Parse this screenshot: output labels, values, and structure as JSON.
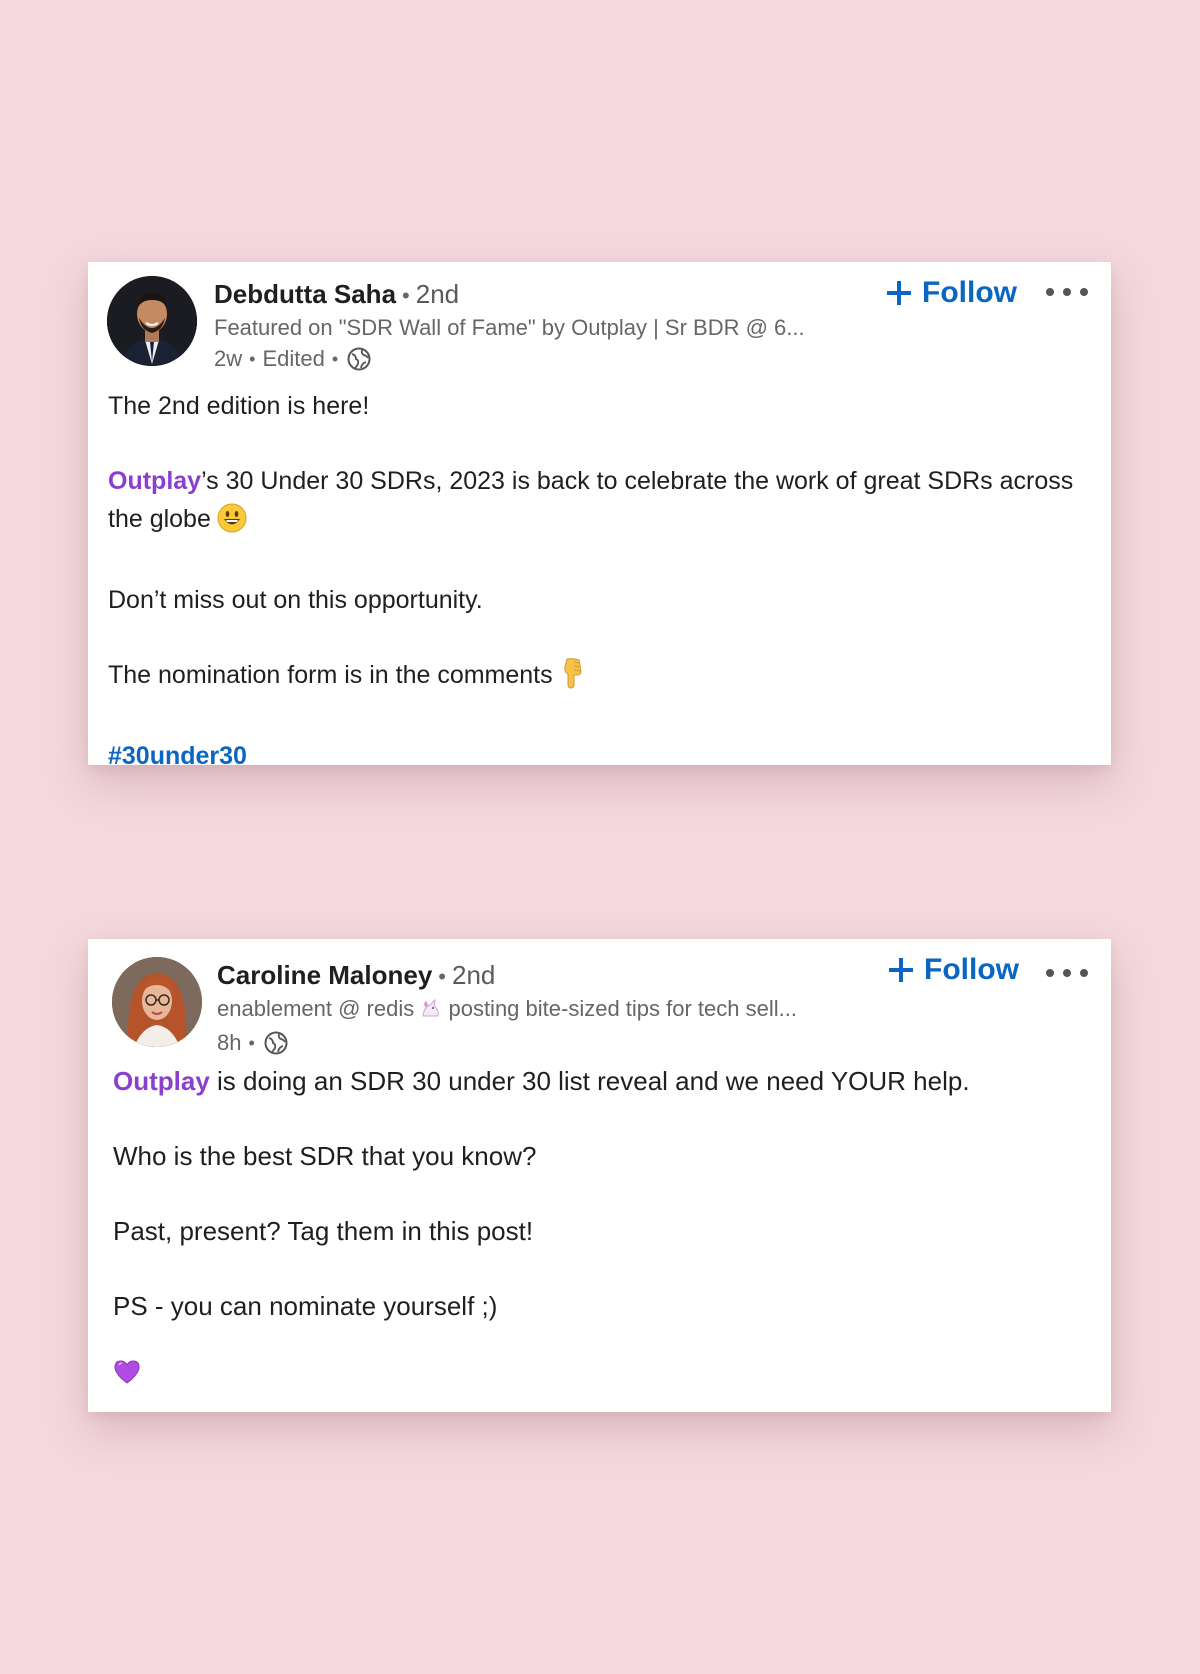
{
  "posts": [
    {
      "author": "Debdutta Saha",
      "degree": "2nd",
      "headline": "Featured on \"SDR Wall of Fame\" by Outplay | Sr BDR @ 6...",
      "time": "2w",
      "edited": "Edited",
      "follow_label": "Follow",
      "line1": "The 2nd edition is here!",
      "mention": "Outplay",
      "line2_rest": "’s 30 Under 30 SDRs, 2023 is back to celebrate the work of great SDRs across the globe",
      "line3": "Don’t miss out on this opportunity.",
      "line4": "The nomination form is in the comments",
      "hashtag": "#30under30"
    },
    {
      "author": "Caroline Maloney",
      "degree": "2nd",
      "headline_a": "enablement @ redis",
      "headline_b": "posting bite-sized tips for tech sell...",
      "time": "8h",
      "follow_label": "Follow",
      "mention": "Outplay",
      "line1_rest": " is doing an SDR 30 under 30 list reveal and we need YOUR help.",
      "line2": "Who is the best SDR that you know?",
      "line3": "Past, present? Tag them in this post!",
      "line4": "PS - you can nominate yourself ;)"
    }
  ],
  "icons": {
    "globe": "globe-icon",
    "follow_plus": "plus-icon",
    "more": "ellipsis-icon",
    "smile": "grinning-face-emoji",
    "point_down": "backhand-index-pointing-down-emoji",
    "unicorn": "unicorn-emoji",
    "heart": "purple-heart-emoji"
  },
  "colors": {
    "background": "#f4d8de",
    "link_blue": "#0a66c2",
    "mention_purple": "#8a3fcf"
  }
}
